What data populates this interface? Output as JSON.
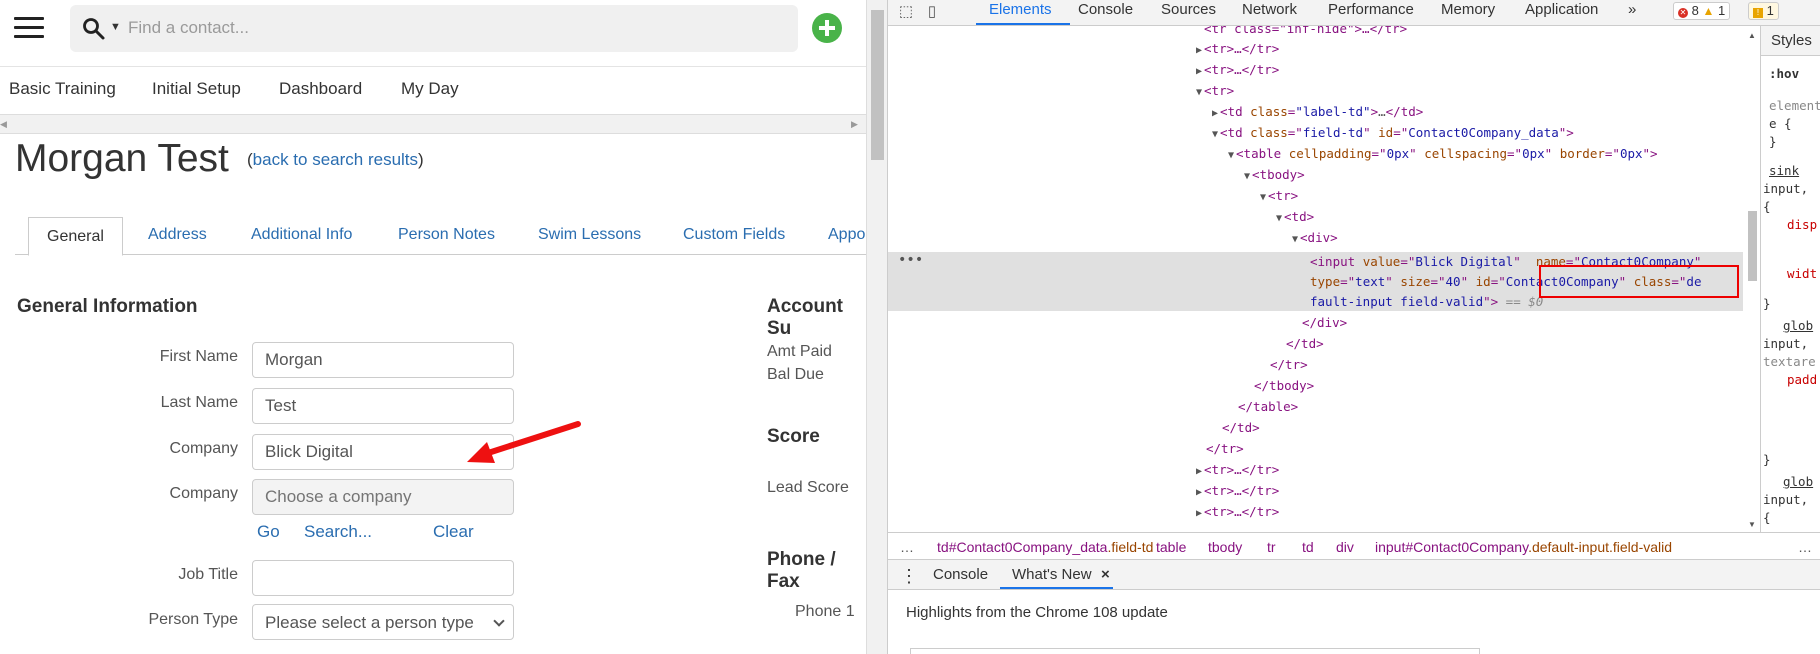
{
  "app": {
    "search": {
      "placeholder": "Find a contact..."
    },
    "nav": [
      "Basic Training",
      "Initial Setup",
      "Dashboard",
      "My Day"
    ],
    "contact_name": "Morgan Test",
    "back_prefix": "(",
    "back_link": "back to search results",
    "back_suffix": ")",
    "tabs": [
      "General",
      "Address",
      "Additional Info",
      "Person Notes",
      "Swim Lessons",
      "Custom Fields",
      "Appo"
    ],
    "general_title": "General Information",
    "fields": {
      "first_name": {
        "label": "First Name",
        "value": "Morgan"
      },
      "last_name": {
        "label": "Last Name",
        "value": "Test"
      },
      "company": {
        "label": "Company",
        "value": "Blick Digital"
      },
      "company_picker": {
        "label": "Company",
        "placeholder": "Choose a company"
      },
      "job_title": {
        "label": "Job Title",
        "value": ""
      },
      "person_type": {
        "label": "Person Type",
        "value": "Please select a person type"
      }
    },
    "company_links": {
      "go": "Go",
      "search": "Search...",
      "clear": "Clear"
    },
    "account_title": "Account Su",
    "amt_paid": "Amt Paid",
    "bal_due": "Bal Due",
    "score_title": "Score",
    "lead_score": "Lead Score",
    "phone_title": "Phone / Fax",
    "phone1": "Phone 1",
    "accent_color": "#49b349",
    "link_color": "#2a6db0"
  },
  "devtools": {
    "tabs": [
      "Elements",
      "Console",
      "Sources",
      "Network",
      "Performance",
      "Memory",
      "Application"
    ],
    "more": "»",
    "errors": "8",
    "warnings": "1",
    "issues": "1",
    "styles_tab": "Styles",
    "dom": {
      "top_partial": "<tr class=\"inf-hide\">…</tr>",
      "collapsed_tr": "<tr>…</tr>",
      "open_tr": "<tr>",
      "label_td": [
        "<td ",
        "class",
        "=\"",
        "label-td",
        "\">…</td>"
      ],
      "field_td_attr_class": "field-td",
      "field_td_attr_id": "Contact0Company_data",
      "table_attrs": {
        "cellpadding": "0px",
        "cellspacing": "0px",
        "border": "0px"
      },
      "tbody": "<tbody>",
      "tr": "<tr>",
      "td": "<td>",
      "div": "<div>",
      "input_value": "Blick Digital",
      "input_name": "Contact0Company",
      "input_type": "text",
      "input_size": "40",
      "input_id": "Contact0Company",
      "input_class_a": "de",
      "input_class_b": "fault-input field-valid",
      "eq0": "== $0",
      "close_div": "</div>",
      "close_td": "</td>",
      "close_tr": "</tr>",
      "close_tbody": "</tbody>",
      "close_table": "</table>"
    },
    "styles": {
      "s1": ":hov",
      "s2": "element",
      "s3": "e {",
      "s4": "}",
      "s5": "sink",
      "s6": "input,",
      "s7": "{",
      "s8": "disp",
      "s9": "widt",
      "s10": "}",
      "s11": "glob",
      "s12": "input,",
      "s13": "textare",
      "s14": "padd",
      "s15": "}",
      "s16": "glob",
      "s17": "input,",
      "s18": "{"
    },
    "breadcrumbs": {
      "more": "…",
      "b1a": "td",
      "b1b": "#Contact0Company_data",
      "b1c": ".field-td",
      "b2": "table",
      "b3": "tbody",
      "b4": "tr",
      "b5": "td",
      "b6": "div",
      "b7a": "input",
      "b7b": "#Contact0Company",
      "b7c": ".default-input.field-valid",
      "end": "…"
    },
    "drawer": {
      "tabs": [
        "Console",
        "What's New"
      ],
      "close": "×",
      "highlights": "Highlights from the Chrome 108 update"
    },
    "accent_color": "#1a73e8",
    "highlight_color": "#e00000"
  }
}
